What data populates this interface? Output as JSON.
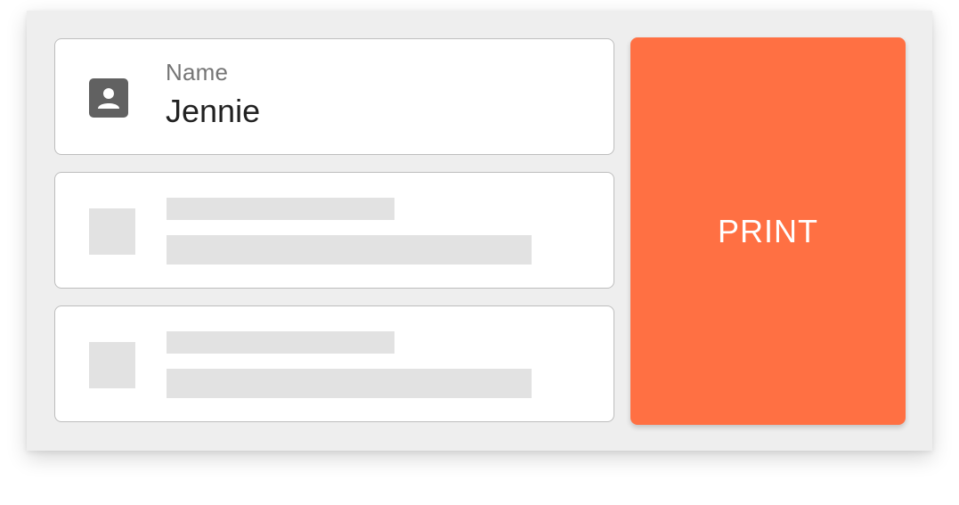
{
  "colors": {
    "panel_background": "#eeeeee",
    "card_background": "#ffffff",
    "card_border": "#bdbdbd",
    "placeholder": "#e2e2e2",
    "accent": "#ff7043",
    "label_text": "#757575",
    "value_text": "#212121",
    "icon": "#616161"
  },
  "contact_card": {
    "icon": "contact-icon",
    "label": "Name",
    "value": "Jennie"
  },
  "placeholder_cards": [
    {
      "state": "loading"
    },
    {
      "state": "loading"
    }
  ],
  "print_button": {
    "label": "PRINT"
  }
}
